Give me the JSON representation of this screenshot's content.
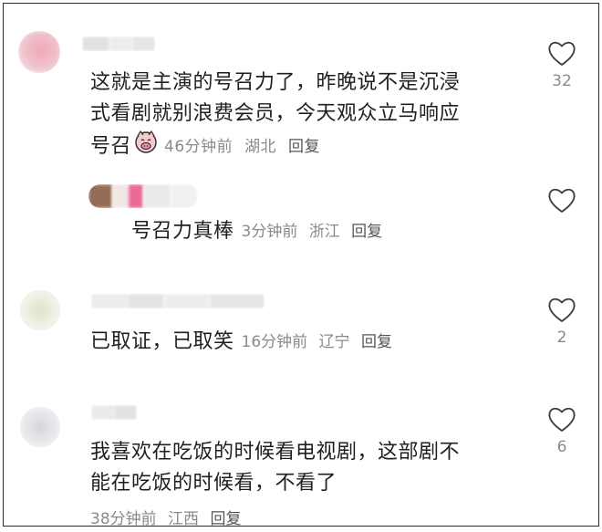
{
  "comments": [
    {
      "text_lines": [
        "这就是主演的号召力了，昨晚说不是沉浸",
        "式看剧就别浪费会员，今天观众立马响应",
        "号召"
      ],
      "emoji": "piggy-face-emoji",
      "time": "46分钟前",
      "location": "湖北",
      "reply": "回复",
      "likes": "32"
    },
    {
      "text": "号召力真棒",
      "time": "3分钟前",
      "location": "浙江",
      "reply": "回复",
      "likes": ""
    },
    {
      "text": "已取证，已取笑",
      "time": "16分钟前",
      "location": "辽宁",
      "reply": "回复",
      "likes": "2"
    },
    {
      "text_lines": [
        "我喜欢在吃饭的时候看电视剧，这部剧不",
        "能在吃饭的时候看，不看了"
      ],
      "time": "38分钟前",
      "location": "江西",
      "reply": "回复",
      "likes": "6"
    }
  ],
  "icons": {
    "like": "heart-outline-icon"
  },
  "colors": {
    "text": "#1f1f1f",
    "meta": "#8a8a8a",
    "icon": "#3a3a3a"
  }
}
